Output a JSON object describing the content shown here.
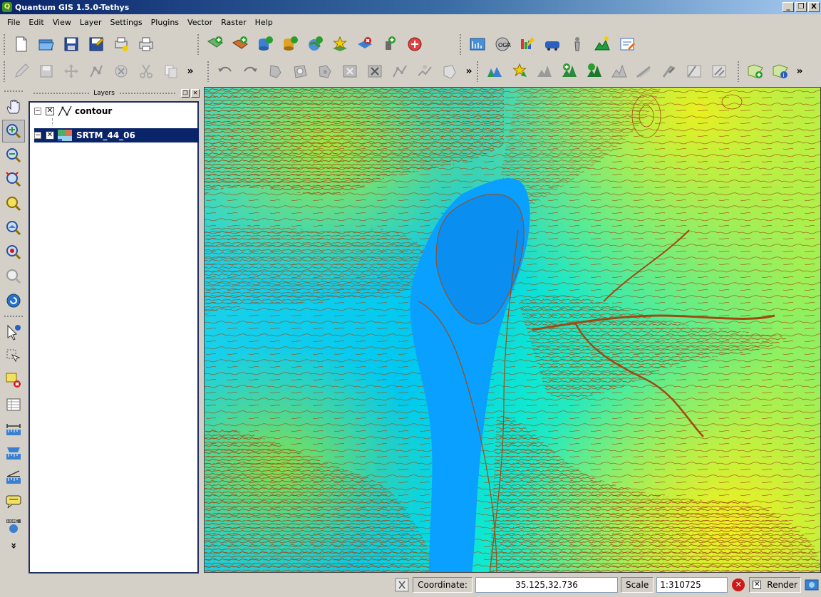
{
  "window": {
    "title": "Quantum GIS 1.5.0-Tethys",
    "app_icon_letter": "Q",
    "buttons": {
      "minimize": "_",
      "restore": "❐",
      "close": "X"
    }
  },
  "menu": [
    "File",
    "Edit",
    "View",
    "Layer",
    "Settings",
    "Plugins",
    "Vector",
    "Raster",
    "Help"
  ],
  "toolbars": {
    "file": [
      "new-project-icon",
      "open-project-icon",
      "save-project-icon",
      "save-as-icon",
      "new-print-composer-icon",
      "print-icon"
    ],
    "layers": [
      "add-vector-layer-icon",
      "add-raster-layer-icon",
      "add-postgis-layer-icon",
      "add-spatialite-layer-icon",
      "add-wms-layer-icon",
      "new-vector-layer-icon",
      "add-wfs-layer-icon",
      "remove-layer-icon",
      "add-gps-layer-icon",
      "add-delimited-text-icon"
    ],
    "plugins": [
      "georeferencer-icon",
      "ogr-converter-icon",
      "raster-terrain-icon",
      "gps-tools-icon",
      "python-console-icon",
      "interpolation-icon",
      "copyright-label-icon"
    ],
    "digitizing": [
      "toggle-editing-icon",
      "save-edits-icon",
      "move-feature-icon",
      "node-tool-icon",
      "delete-selected-icon",
      "cut-features-icon",
      "copy-features-icon"
    ],
    "advanced_digitizing": [
      "undo-icon",
      "redo-icon",
      "simplify-feature-icon",
      "add-ring-icon",
      "add-island-icon",
      "delete-ring-icon",
      "delete-part-icon",
      "reshape-features-icon",
      "split-features-icon",
      "merge-features-icon"
    ],
    "raster": [
      "histogram-stretch-icon",
      "show-tips-icon",
      "full-histogram-icon",
      "contour-add-icon",
      "raster-calc-icon",
      "terrain-hill-icon",
      "profile-icon",
      "slope-icon",
      "aspect-icon",
      "ruggedness-icon",
      "clip-raster-icon"
    ],
    "extra": [
      "add-wkt-icon",
      "identify-plugin-icon"
    ],
    "overflow": "»"
  },
  "left_tools": [
    "pan-icon",
    "zoom-in-icon",
    "zoom-out-icon",
    "zoom-full-icon",
    "zoom-to-selection-icon",
    "zoom-to-layer-icon",
    "zoom-last-icon",
    "zoom-next-icon",
    "refresh-icon",
    "identify-icon",
    "select-features-icon",
    "deselect-all-icon",
    "open-attribute-table-icon",
    "measure-line-icon",
    "measure-area-icon",
    "measure-angle-icon",
    "map-tips-icon",
    "new-bookmark-icon"
  ],
  "layers_panel": {
    "title": "Layers",
    "layers": [
      {
        "name": "contour",
        "visible": true,
        "expanded": false,
        "selected": false,
        "icon": "vector-line-icon"
      },
      {
        "name": "SRTM_44_06",
        "visible": true,
        "expanded": true,
        "selected": true,
        "icon": "raster-icon"
      }
    ]
  },
  "statusbar": {
    "coordinate_label": "Coordinate:",
    "coordinate_value": "35.125,32.736",
    "scale_label": "Scale",
    "scale_value": "1:310725",
    "render_label": "Render",
    "render_checked": true
  },
  "colors": {
    "title_gradient_start": "#0a246a",
    "selection": "#0a246a",
    "dem_low": "#0aa0ff",
    "dem_mid": "#00f0e0",
    "dem_high": "#f0f020",
    "contour": "#a14a10"
  }
}
